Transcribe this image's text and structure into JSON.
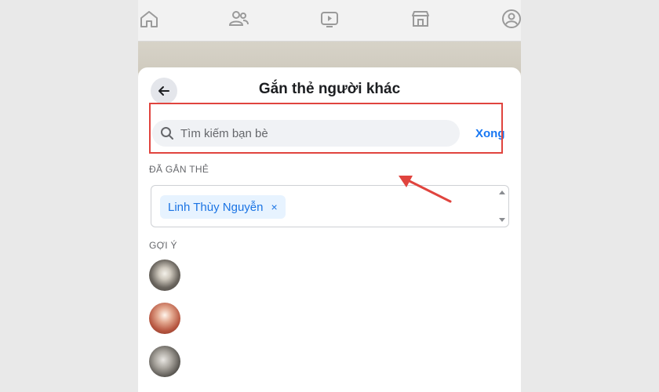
{
  "colors": {
    "accent": "#1877f2",
    "highlight": "#e0443e",
    "chip_bg": "#e7f3ff"
  },
  "nav": {
    "icons": [
      "home-icon",
      "friends-icon",
      "watch-icon",
      "marketplace-icon",
      "groups-icon"
    ]
  },
  "sheet": {
    "title": "Gắn thẻ người khác",
    "back_icon": "arrow-left-icon"
  },
  "search": {
    "placeholder": "Tìm kiếm bạn bè",
    "value": "",
    "icon": "search-icon",
    "done_label": "Xong"
  },
  "tagged": {
    "label": "ĐÃ GẮN THẺ",
    "chips": [
      {
        "name": "Linh Thùy Nguyễn",
        "remove": "×"
      }
    ]
  },
  "suggestions": {
    "label": "GỢI Ý",
    "count_visible": 3
  }
}
